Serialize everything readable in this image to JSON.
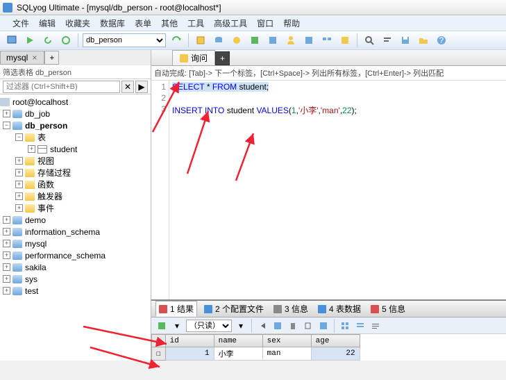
{
  "title": "SQLyog Ultimate - [mysql/db_person - root@localhost*]",
  "menu": [
    "文件",
    "编辑",
    "收藏夹",
    "数据库",
    "表单",
    "其他",
    "工具",
    "高级工具",
    "窗口",
    "帮助"
  ],
  "db_dropdown": "db_person",
  "left_tab": "mysql",
  "filter_label": "筛选表格 db_person",
  "search_placeholder": "过滤器 (Ctrl+Shift+B)",
  "tree": {
    "root": "root@localhost",
    "dbs": [
      {
        "name": "db_job",
        "expanded": false
      },
      {
        "name": "db_person",
        "expanded": true,
        "bold": true,
        "children": [
          {
            "name": "表",
            "type": "folder",
            "expanded": true,
            "children": [
              {
                "name": "student",
                "type": "table"
              }
            ]
          },
          {
            "name": "视图",
            "type": "folder"
          },
          {
            "name": "存储过程",
            "type": "folder"
          },
          {
            "name": "函数",
            "type": "folder"
          },
          {
            "name": "触发器",
            "type": "folder"
          },
          {
            "name": "事件",
            "type": "folder"
          }
        ]
      },
      {
        "name": "demo"
      },
      {
        "name": "information_schema"
      },
      {
        "name": "mysql"
      },
      {
        "name": "performance_schema"
      },
      {
        "name": "sakila"
      },
      {
        "name": "sys"
      },
      {
        "name": "test"
      }
    ]
  },
  "query_tab": "询问",
  "hint": "自动完成:  [Tab]-> 下一个标签，[Ctrl+Space]-> 列出所有标签，[Ctrl+Enter]-> 列出匹配",
  "code": {
    "line1": {
      "select": "SELECT",
      "star": "*",
      "from": "FROM",
      "tbl": "student;"
    },
    "line3": {
      "insert": "INSERT",
      "into": "INTO",
      "tbl": "student",
      "vals": "VALUES",
      "open": "(",
      "n1": "1",
      "s1": "'小李'",
      "s2": "'man'",
      "n2": "22",
      "close": ");"
    }
  },
  "result_tabs": [
    {
      "label": "1 结果",
      "color": "#d94f4f",
      "active": true
    },
    {
      "label": "2 个配置文件",
      "color": "#4a90d9"
    },
    {
      "label": "3 信息",
      "color": "#888"
    },
    {
      "label": "4 表数据",
      "color": "#4a90d9"
    },
    {
      "label": "5 信息",
      "color": "#d94f4f"
    }
  ],
  "readonly_label": "（只读）",
  "grid": {
    "cols": [
      "id",
      "name",
      "sex",
      "age"
    ],
    "rows": [
      {
        "id": "1",
        "name": "小李",
        "sex": "man",
        "age": "22"
      }
    ]
  }
}
